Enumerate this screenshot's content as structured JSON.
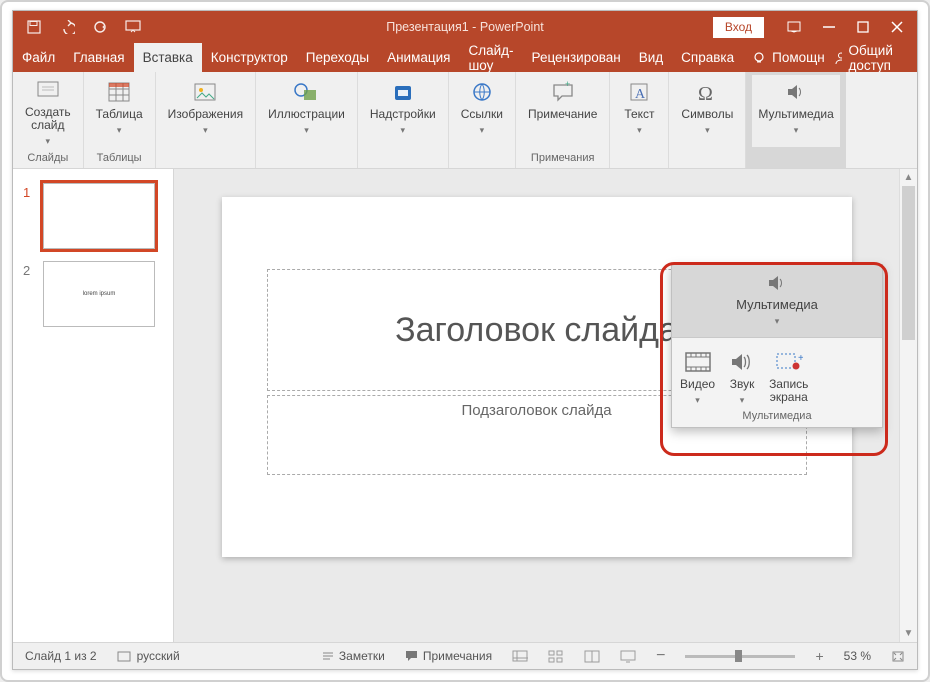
{
  "titlebar": {
    "title": "Презентация1 - PowerPoint",
    "login": "Вход"
  },
  "tabs": [
    "Файл",
    "Главная",
    "Вставка",
    "Конструктор",
    "Переходы",
    "Анимация",
    "Слайд-шоу",
    "Рецензирован",
    "Вид",
    "Справка"
  ],
  "active_tab": 2,
  "tell_me": "Помощн",
  "share": "Общий доступ",
  "ribbon": {
    "new_slide": "Создать\nслайд",
    "slides": "Слайды",
    "table": "Таблица",
    "tables": "Таблицы",
    "images": "Изображения",
    "illustrations": "Иллюстрации",
    "addins": "Надстройки",
    "links": "Ссылки",
    "comment": "Примечание",
    "comments": "Примечания",
    "text": "Текст",
    "symbols": "Символы",
    "multimedia": "Мультимедиа"
  },
  "popup": {
    "header": "Мультимедиа",
    "video": "Видео",
    "audio": "Звук",
    "screen_rec": "Запись\nэкрана",
    "group": "Мультимедиа"
  },
  "slides": {
    "count": 2,
    "active": 1,
    "thumb2_text": "lorem ipsum"
  },
  "canvas": {
    "title": "Заголовок слайда",
    "subtitle": "Подзаголовок слайда"
  },
  "status": {
    "slide_counter": "Слайд 1 из 2",
    "language": "русский",
    "notes": "Заметки",
    "comments": "Примечания",
    "zoom": "53 %"
  }
}
